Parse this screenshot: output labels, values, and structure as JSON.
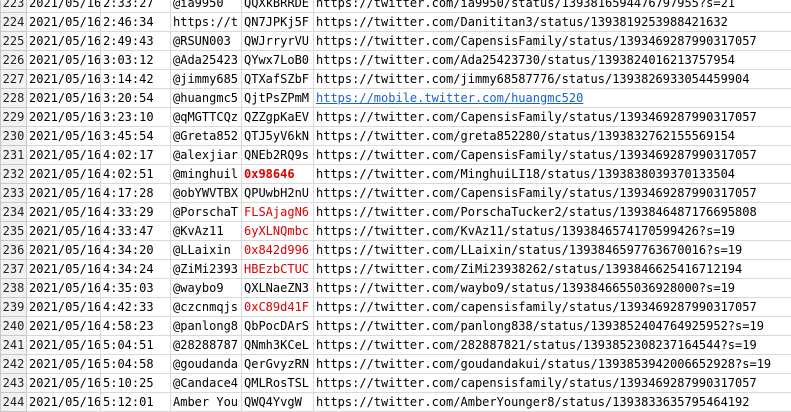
{
  "sheet": {
    "rows": [
      {
        "num": "223",
        "date": "2021/05/16",
        "time": "2:33:27",
        "user": "@ia9950",
        "id": "QQXkBRRDE",
        "url": "https://twitter.com/ia9950/status/1393816594476797955?s=21",
        "id_style": ""
      },
      {
        "num": "224",
        "date": "2021/05/16",
        "time": "2:46:34",
        "user": "https://t",
        "id": "QN7JPKj5F",
        "url": "https://twitter.com/Danititan3/status/1393819253988421632",
        "id_style": ""
      },
      {
        "num": "225",
        "date": "2021/05/16",
        "time": "2:49:43",
        "user": "@RSUN003",
        "id": "QWJrryrVU",
        "url": "https://twitter.com/CapensisFamily/status/1393469287990317057",
        "id_style": ""
      },
      {
        "num": "226",
        "date": "2021/05/16",
        "time": "3:03:12",
        "user": "@Ada25423",
        "id": "QYwx7LoB0",
        "url": "https://twitter.com/Ada25423730/status/1393824016213757954",
        "id_style": ""
      },
      {
        "num": "227",
        "date": "2021/05/16",
        "time": "3:14:42",
        "user": "@jimmy685",
        "id": "QTXafSZbF",
        "url": "https://twitter.com/jimmy68587776/status/1393826933054459904",
        "id_style": ""
      },
      {
        "num": "228",
        "date": "2021/05/16",
        "time": "3:20:54",
        "user": "@huangmc5",
        "id": "QjtPsZPmM",
        "url": "https://mobile.twitter.com/huangmc520",
        "id_style": "",
        "url_link": true
      },
      {
        "num": "229",
        "date": "2021/05/16",
        "time": "3:23:10",
        "user": "@qMGTTCQz",
        "id": "QZZgpKaEV",
        "url": "https://twitter.com/CapensisFamily/status/1393469287990317057",
        "id_style": ""
      },
      {
        "num": "230",
        "date": "2021/05/16",
        "time": "3:45:54",
        "user": "@Greta852",
        "id": "QTJ5yV6kN",
        "url": "https://twitter.com/greta852280/status/1393832762155569154",
        "id_style": ""
      },
      {
        "num": "231",
        "date": "2021/05/16",
        "time": "4:02:17",
        "user": "@alexjiar",
        "id": "QNEb2RQ9s",
        "url": "https://twitter.com/CapensisFamily/status/1393469287990317057",
        "id_style": ""
      },
      {
        "num": "232",
        "date": "2021/05/16",
        "time": "4:02:51",
        "user": "@minghuil",
        "id": "0x98646",
        "url": "https://twitter.com/MinghuiLI18/status/1393838039370133504",
        "id_style": "red bold"
      },
      {
        "num": "233",
        "date": "2021/05/16",
        "time": "4:17:28",
        "user": "@obYWVTBX",
        "id": "QPUwbH2nU",
        "url": "https://twitter.com/CapensisFamily/status/1393469287990317057",
        "id_style": ""
      },
      {
        "num": "234",
        "date": "2021/05/16",
        "time": "4:33:29",
        "user": "@PorschaT",
        "id": "FLSAjagN6",
        "url": "https://twitter.com/PorschaTucker2/status/1393846487176695808",
        "id_style": "red"
      },
      {
        "num": "235",
        "date": "2021/05/16",
        "time": "4:33:47",
        "user": "@KvAz11",
        "id": "6yXLNQmbc",
        "url": "https://twitter.com/KvAz11/status/1393846574170599426?s=19",
        "id_style": "red"
      },
      {
        "num": "236",
        "date": "2021/05/16",
        "time": "4:34:20",
        "user": "@LLaixin",
        "id": "0x842d996",
        "url": "https://twitter.com/LLaixin/status/1393846597763670016?s=19",
        "id_style": "red"
      },
      {
        "num": "237",
        "date": "2021/05/16",
        "time": "4:34:24",
        "user": "@ZiMi2393",
        "id": "HBEzbCTUC",
        "url": "https://twitter.com/ZiMi23938262/status/1393846625416712194",
        "id_style": "red"
      },
      {
        "num": "238",
        "date": "2021/05/16",
        "time": "4:35:03",
        "user": "@waybo9",
        "id": "QXLNaeZN3",
        "url": "https://twitter.com/waybo9/status/1393846655036928000?s=19",
        "id_style": ""
      },
      {
        "num": "239",
        "date": "2021/05/16",
        "time": "4:42:33",
        "user": "@czcnmqjs",
        "id": "0xC89d41F",
        "url": "https://twitter.com/capensisfamily/status/1393469287990317057",
        "id_style": "red"
      },
      {
        "num": "240",
        "date": "2021/05/16",
        "time": "4:58:23",
        "user": "@panlong8",
        "id": "QbPocDArS",
        "url": "https://twitter.com/panlong838/status/1393852404764925952?s=19",
        "id_style": ""
      },
      {
        "num": "241",
        "date": "2021/05/16",
        "time": "5:04:51",
        "user": "@28288787",
        "id": "QNmh3KCeL",
        "url": "https://twitter.com/282887821/status/1393852308237164544?s=19",
        "id_style": ""
      },
      {
        "num": "242",
        "date": "2021/05/16",
        "time": "5:04:58",
        "user": "@goudanda",
        "id": "QerGvyzRN",
        "url": "https://twitter.com/goudandakui/status/1393853942006652928?s=19",
        "id_style": ""
      },
      {
        "num": "243",
        "date": "2021/05/16",
        "time": "5:10:25",
        "user": "@Candace4",
        "id": "QMLRosTSL",
        "url": "https://twitter.com/capensisfamily/status/1393469287990317057",
        "id_style": ""
      },
      {
        "num": "244",
        "date": "2021/05/16",
        "time": "5:12:01",
        "user": "Amber You",
        "id": "QWQ4YvgW",
        "url": "https://twitter.com/AmberYounger8/status/1393833635795464192",
        "id_style": ""
      }
    ]
  }
}
